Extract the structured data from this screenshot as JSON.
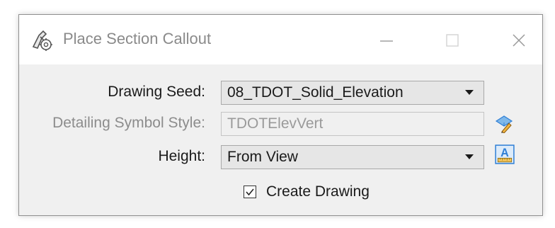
{
  "window": {
    "title": "Place Section Callout",
    "title_icon": "place-callout-tool-icon",
    "controls": {
      "minimize": "—",
      "maximize": "☐",
      "close": "✕"
    }
  },
  "form": {
    "drawing_seed": {
      "label": "Drawing Seed:",
      "value": "08_TDOT_Solid_Elevation"
    },
    "detailing_symbol_style": {
      "label": "Detailing Symbol Style:",
      "value": "TDOTElevVert",
      "enabled": false,
      "side_icon": "pick-style-eyedropper-icon"
    },
    "height": {
      "label": "Height:",
      "value": "From View",
      "side_icon": "text-style-icon"
    },
    "create_drawing": {
      "label": "Create Drawing",
      "checked": true
    }
  },
  "colors": {
    "dialog_bg": "#f0f0f0",
    "titlebar_bg": "#ffffff",
    "disabled_text": "#8c8c8c",
    "accent_blue": "#2f7fd6"
  }
}
